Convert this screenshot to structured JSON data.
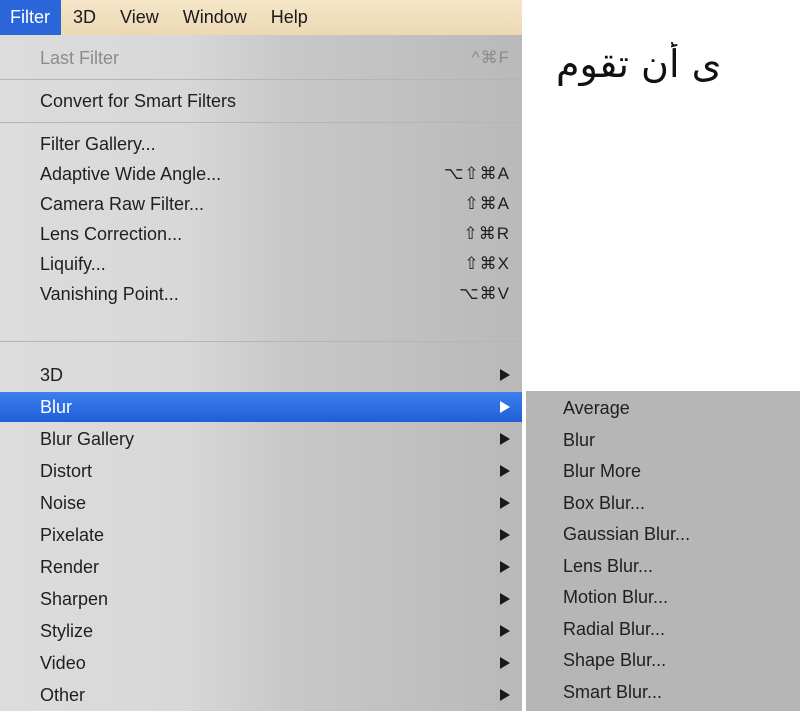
{
  "menubar": {
    "items": [
      {
        "label": "Filter"
      },
      {
        "label": "3D"
      },
      {
        "label": "View"
      },
      {
        "label": "Window"
      },
      {
        "label": "Help"
      }
    ]
  },
  "background_text": "ى أن تقوم",
  "menu": {
    "items": [
      {
        "label": "Last Filter",
        "shortcut": "^⌘F",
        "disabled": true
      },
      {
        "label": "Convert for Smart Filters"
      },
      {
        "label": "Filter Gallery..."
      },
      {
        "label": "Adaptive Wide Angle...",
        "shortcut": "⌥⇧⌘A"
      },
      {
        "label": "Camera Raw Filter...",
        "shortcut": "⇧⌘A"
      },
      {
        "label": "Lens Correction...",
        "shortcut": "⇧⌘R"
      },
      {
        "label": "Liquify...",
        "shortcut": "⇧⌘X"
      },
      {
        "label": "Vanishing Point...",
        "shortcut": "⌥⌘V"
      },
      {
        "label": "3D",
        "submenu": true
      },
      {
        "label": "Blur",
        "submenu": true,
        "highlighted": true
      },
      {
        "label": "Blur Gallery",
        "submenu": true
      },
      {
        "label": "Distort",
        "submenu": true
      },
      {
        "label": "Noise",
        "submenu": true
      },
      {
        "label": "Pixelate",
        "submenu": true
      },
      {
        "label": "Render",
        "submenu": true
      },
      {
        "label": "Sharpen",
        "submenu": true
      },
      {
        "label": "Stylize",
        "submenu": true
      },
      {
        "label": "Video",
        "submenu": true
      },
      {
        "label": "Other",
        "submenu": true
      }
    ]
  },
  "blur_submenu": {
    "items": [
      {
        "label": "Average"
      },
      {
        "label": "Blur"
      },
      {
        "label": "Blur More"
      },
      {
        "label": "Box Blur..."
      },
      {
        "label": "Gaussian Blur..."
      },
      {
        "label": "Lens Blur..."
      },
      {
        "label": "Motion Blur..."
      },
      {
        "label": "Radial Blur..."
      },
      {
        "label": "Shape Blur..."
      },
      {
        "label": "Smart Blur..."
      }
    ]
  },
  "colors": {
    "highlight": "#2a66d9",
    "menubar": "#f5e6c8",
    "menu_bg": "#d8d8d8",
    "submenu_bg": "#b6b6b6"
  }
}
